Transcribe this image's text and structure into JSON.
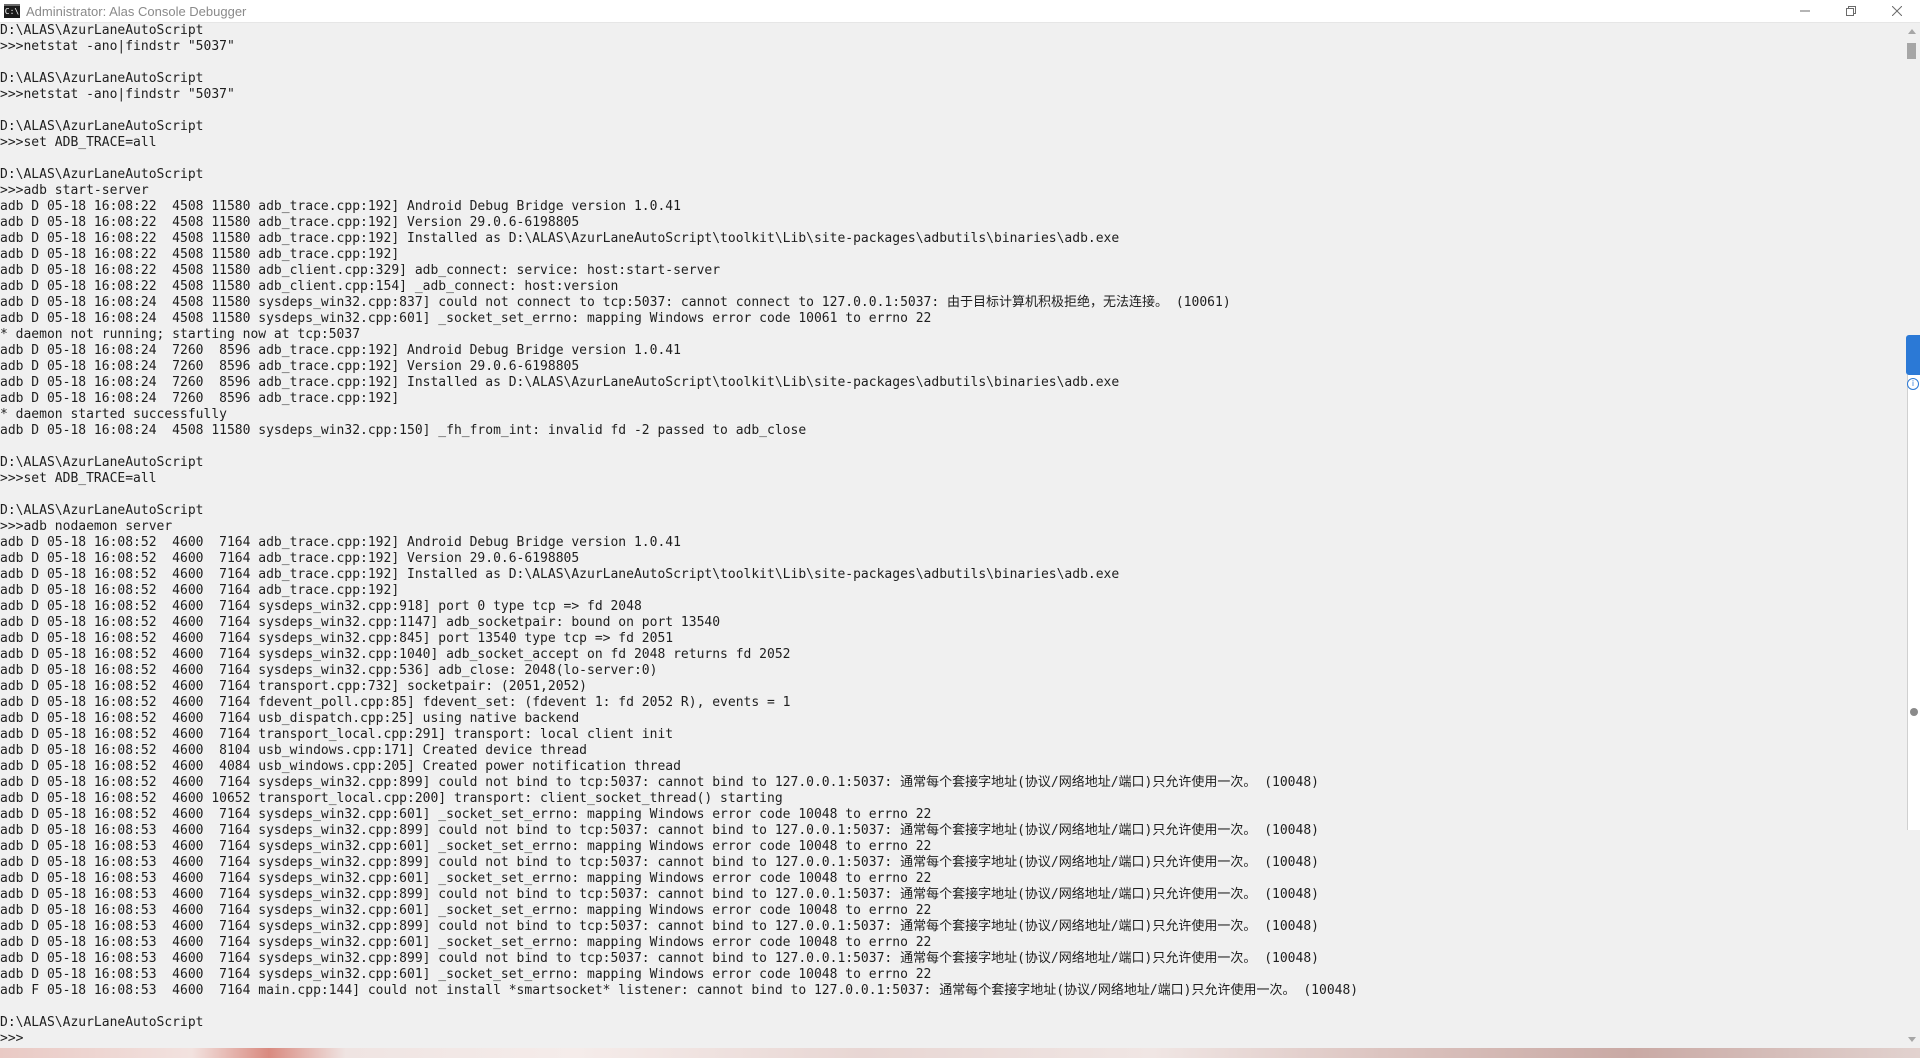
{
  "window": {
    "title": "Administrator:  Alas Console Debugger",
    "icon": "cmd-icon",
    "icon_text": "C:\\",
    "controls": [
      "minimize-icon",
      "restore-icon",
      "close-icon"
    ]
  },
  "console": {
    "lines": [
      "D:\\ALAS\\AzurLaneAutoScript",
      ">>>netstat -ano|findstr \"5037\"",
      "",
      "D:\\ALAS\\AzurLaneAutoScript",
      ">>>netstat -ano|findstr \"5037\"",
      "",
      "D:\\ALAS\\AzurLaneAutoScript",
      ">>>set ADB_TRACE=all",
      "",
      "D:\\ALAS\\AzurLaneAutoScript",
      ">>>adb start-server",
      "adb D 05-18 16:08:22  4508 11580 adb_trace.cpp:192] Android Debug Bridge version 1.0.41",
      "adb D 05-18 16:08:22  4508 11580 adb_trace.cpp:192] Version 29.0.6-6198805",
      "adb D 05-18 16:08:22  4508 11580 adb_trace.cpp:192] Installed as D:\\ALAS\\AzurLaneAutoScript\\toolkit\\Lib\\site-packages\\adbutils\\binaries\\adb.exe",
      "adb D 05-18 16:08:22  4508 11580 adb_trace.cpp:192]",
      "adb D 05-18 16:08:22  4508 11580 adb_client.cpp:329] adb_connect: service: host:start-server",
      "adb D 05-18 16:08:22  4508 11580 adb_client.cpp:154] _adb_connect: host:version",
      "adb D 05-18 16:08:24  4508 11580 sysdeps_win32.cpp:837] could not connect to tcp:5037: cannot connect to 127.0.0.1:5037: 由于目标计算机积极拒绝，无法连接。 (10061)",
      "adb D 05-18 16:08:24  4508 11580 sysdeps_win32.cpp:601] _socket_set_errno: mapping Windows error code 10061 to errno 22",
      "* daemon not running; starting now at tcp:5037",
      "adb D 05-18 16:08:24  7260  8596 adb_trace.cpp:192] Android Debug Bridge version 1.0.41",
      "adb D 05-18 16:08:24  7260  8596 adb_trace.cpp:192] Version 29.0.6-6198805",
      "adb D 05-18 16:08:24  7260  8596 adb_trace.cpp:192] Installed as D:\\ALAS\\AzurLaneAutoScript\\toolkit\\Lib\\site-packages\\adbutils\\binaries\\adb.exe",
      "adb D 05-18 16:08:24  7260  8596 adb_trace.cpp:192]",
      "* daemon started successfully",
      "adb D 05-18 16:08:24  4508 11580 sysdeps_win32.cpp:150] _fh_from_int: invalid fd -2 passed to adb_close",
      "",
      "D:\\ALAS\\AzurLaneAutoScript",
      ">>>set ADB_TRACE=all",
      "",
      "D:\\ALAS\\AzurLaneAutoScript",
      ">>>adb nodaemon server",
      "adb D 05-18 16:08:52  4600  7164 adb_trace.cpp:192] Android Debug Bridge version 1.0.41",
      "adb D 05-18 16:08:52  4600  7164 adb_trace.cpp:192] Version 29.0.6-6198805",
      "adb D 05-18 16:08:52  4600  7164 adb_trace.cpp:192] Installed as D:\\ALAS\\AzurLaneAutoScript\\toolkit\\Lib\\site-packages\\adbutils\\binaries\\adb.exe",
      "adb D 05-18 16:08:52  4600  7164 adb_trace.cpp:192]",
      "adb D 05-18 16:08:52  4600  7164 sysdeps_win32.cpp:918] port 0 type tcp => fd 2048",
      "adb D 05-18 16:08:52  4600  7164 sysdeps_win32.cpp:1147] adb_socketpair: bound on port 13540",
      "adb D 05-18 16:08:52  4600  7164 sysdeps_win32.cpp:845] port 13540 type tcp => fd 2051",
      "adb D 05-18 16:08:52  4600  7164 sysdeps_win32.cpp:1040] adb_socket_accept on fd 2048 returns fd 2052",
      "adb D 05-18 16:08:52  4600  7164 sysdeps_win32.cpp:536] adb_close: 2048(lo-server:0)",
      "adb D 05-18 16:08:52  4600  7164 transport.cpp:732] socketpair: (2051,2052)",
      "adb D 05-18 16:08:52  4600  7164 fdevent_poll.cpp:85] fdevent_set: (fdevent 1: fd 2052 R), events = 1",
      "adb D 05-18 16:08:52  4600  7164 usb_dispatch.cpp:25] using native backend",
      "adb D 05-18 16:08:52  4600  7164 transport_local.cpp:291] transport: local client init",
      "adb D 05-18 16:08:52  4600  8104 usb_windows.cpp:171] Created device thread",
      "adb D 05-18 16:08:52  4600  4084 usb_windows.cpp:205] Created power notification thread",
      "adb D 05-18 16:08:52  4600  7164 sysdeps_win32.cpp:899] could not bind to tcp:5037: cannot bind to 127.0.0.1:5037: 通常每个套接字地址(协议/网络地址/端口)只允许使用一次。 (10048)",
      "adb D 05-18 16:08:52  4600 10652 transport_local.cpp:200] transport: client_socket_thread() starting",
      "adb D 05-18 16:08:52  4600  7164 sysdeps_win32.cpp:601] _socket_set_errno: mapping Windows error code 10048 to errno 22",
      "adb D 05-18 16:08:53  4600  7164 sysdeps_win32.cpp:899] could not bind to tcp:5037: cannot bind to 127.0.0.1:5037: 通常每个套接字地址(协议/网络地址/端口)只允许使用一次。 (10048)",
      "adb D 05-18 16:08:53  4600  7164 sysdeps_win32.cpp:601] _socket_set_errno: mapping Windows error code 10048 to errno 22",
      "adb D 05-18 16:08:53  4600  7164 sysdeps_win32.cpp:899] could not bind to tcp:5037: cannot bind to 127.0.0.1:5037: 通常每个套接字地址(协议/网络地址/端口)只允许使用一次。 (10048)",
      "adb D 05-18 16:08:53  4600  7164 sysdeps_win32.cpp:601] _socket_set_errno: mapping Windows error code 10048 to errno 22",
      "adb D 05-18 16:08:53  4600  7164 sysdeps_win32.cpp:899] could not bind to tcp:5037: cannot bind to 127.0.0.1:5037: 通常每个套接字地址(协议/网络地址/端口)只允许使用一次。 (10048)",
      "adb D 05-18 16:08:53  4600  7164 sysdeps_win32.cpp:601] _socket_set_errno: mapping Windows error code 10048 to errno 22",
      "adb D 05-18 16:08:53  4600  7164 sysdeps_win32.cpp:899] could not bind to tcp:5037: cannot bind to 127.0.0.1:5037: 通常每个套接字地址(协议/网络地址/端口)只允许使用一次。 (10048)",
      "adb D 05-18 16:08:53  4600  7164 sysdeps_win32.cpp:601] _socket_set_errno: mapping Windows error code 10048 to errno 22",
      "adb D 05-18 16:08:53  4600  7164 sysdeps_win32.cpp:899] could not bind to tcp:5037: cannot bind to 127.0.0.1:5037: 通常每个套接字地址(协议/网络地址/端口)只允许使用一次。 (10048)",
      "adb D 05-18 16:08:53  4600  7164 sysdeps_win32.cpp:601] _socket_set_errno: mapping Windows error code 10048 to errno 22",
      "adb F 05-18 16:08:53  4600  7164 main.cpp:144] could not install *smartsocket* listener: cannot bind to 127.0.0.1:5037: 通常每个套接字地址(协议/网络地址/端口)只允许使用一次。 (10048)",
      "",
      "D:\\ALAS\\AzurLaneAutoScript",
      ">>>"
    ]
  },
  "scrollbar": {
    "position_fraction": 0.0
  },
  "side_panel": {
    "info_icon": "info-icon",
    "info_glyph": "i"
  },
  "colors": {
    "console_bg": "#f0f0f0",
    "console_fg": "#1e1e1e",
    "accent": "#2b79d6"
  }
}
